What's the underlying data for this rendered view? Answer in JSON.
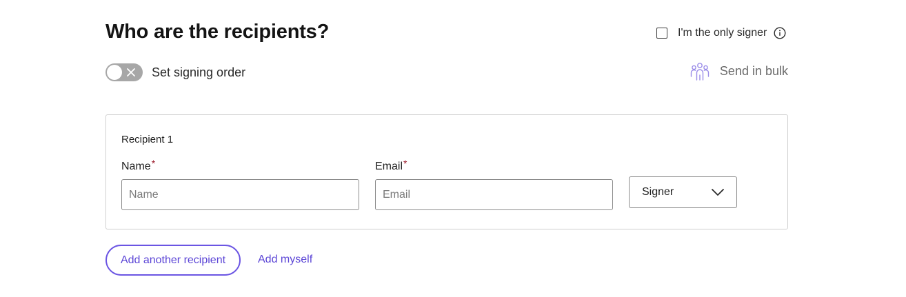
{
  "heading": "Who are the recipients?",
  "only_signer": {
    "label": "I'm the only signer",
    "checked": false
  },
  "signing_order": {
    "label": "Set signing order",
    "enabled": false
  },
  "bulk": {
    "label": "Send in bulk",
    "icon": "people-group-icon"
  },
  "recipient": {
    "heading": "Recipient 1",
    "name_label": "Name",
    "name_placeholder": "Name",
    "email_label": "Email",
    "email_placeholder": "Email",
    "required_marker": "*",
    "role_value": "Signer"
  },
  "actions": {
    "add_recipient": "Add another recipient",
    "add_myself": "Add myself"
  },
  "colors": {
    "accent": "#6b55e3",
    "required": "#9b1b2a",
    "toggle_off": "#a7a7a7",
    "bulk_icon": "#9a8ce8"
  }
}
